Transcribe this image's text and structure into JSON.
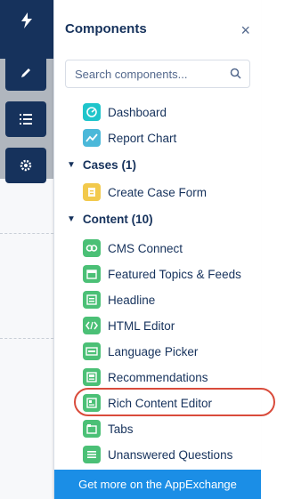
{
  "panel": {
    "title": "Components",
    "close_symbol": "×",
    "search_placeholder": "Search components..."
  },
  "items": [
    {
      "label": "Dashboard",
      "icon": "dashboard-icon",
      "color": "#1fc5cb"
    },
    {
      "label": "Report Chart",
      "icon": "report-chart-icon",
      "color": "#4bb8d9"
    }
  ],
  "sections": [
    {
      "label": "Cases (1)",
      "items": [
        {
          "label": "Create Case Form",
          "icon": "case-form-icon",
          "color": "#f2c94c"
        }
      ]
    },
    {
      "label": "Content (10)",
      "items": [
        {
          "label": "CMS Connect",
          "icon": "cms-connect-icon",
          "color": "#4bc076"
        },
        {
          "label": "Featured Topics & Feeds",
          "icon": "featured-topics-icon",
          "color": "#4bc076"
        },
        {
          "label": "Headline",
          "icon": "headline-icon",
          "color": "#4bc076"
        },
        {
          "label": "HTML Editor",
          "icon": "html-editor-icon",
          "color": "#4bc076"
        },
        {
          "label": "Language Picker",
          "icon": "language-picker-icon",
          "color": "#4bc076"
        },
        {
          "label": "Recommendations",
          "icon": "recommendations-icon",
          "color": "#4bc076"
        },
        {
          "label": "Rich Content Editor",
          "icon": "rich-content-editor-icon",
          "color": "#4bc076"
        },
        {
          "label": "Tabs",
          "icon": "tabs-icon",
          "color": "#4bc076"
        },
        {
          "label": "Unanswered Questions",
          "icon": "unanswered-questions-icon",
          "color": "#4bc076"
        }
      ]
    }
  ],
  "footer": {
    "label": "Get more on the AppExchange"
  },
  "colors": {
    "brand_navy": "#16325c",
    "accent_blue": "#1b8ee6",
    "highlight_red": "#d94b3b"
  }
}
